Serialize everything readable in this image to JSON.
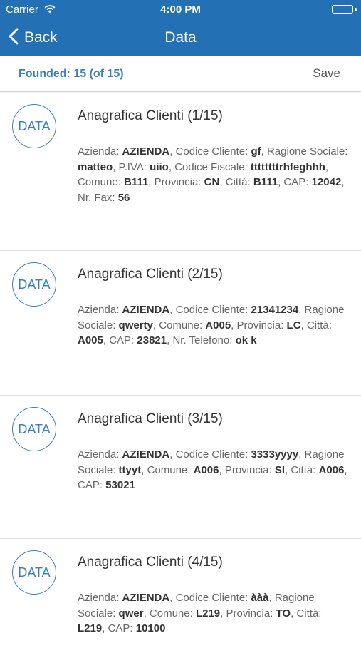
{
  "status_bar": {
    "carrier": "Carrier",
    "time": "4:00 PM",
    "battery_level": 1.0,
    "battery_color": "#7ed43c"
  },
  "nav": {
    "back_label": "Back",
    "title": "Data",
    "background": "#2370b5"
  },
  "info_bar": {
    "founded": "Founded: 15 (of 15)",
    "save_label": "Save"
  },
  "items": [
    {
      "badge": "DATA",
      "title": "Anagrafica Clienti (1/15)",
      "fields": [
        {
          "label": "Azienda: ",
          "value": "AZIENDA",
          "sep": ", "
        },
        {
          "label": "Codice Cliente: ",
          "value": "gf",
          "sep": ", "
        },
        {
          "label": "Ragione Sociale: ",
          "value": "matteo",
          "sep": ", "
        },
        {
          "label": "P.IVA: ",
          "value": "uiio",
          "sep": ", "
        },
        {
          "label": "Codice Fiscale: ",
          "value": "ttttttttrhfeghhh",
          "sep": ", "
        },
        {
          "label": "Comune: ",
          "value": "B111",
          "sep": ", "
        },
        {
          "label": "Provincia: ",
          "value": "CN",
          "sep": ", "
        },
        {
          "label": "Città: ",
          "value": "B111",
          "sep": ", "
        },
        {
          "label": "CAP: ",
          "value": "12042",
          "sep": ", "
        },
        {
          "label": "Nr. Fax: ",
          "value": "56",
          "sep": ""
        }
      ]
    },
    {
      "badge": "DATA",
      "title": "Anagrafica Clienti (2/15)",
      "fields": [
        {
          "label": "Azienda: ",
          "value": "AZIENDA",
          "sep": ", "
        },
        {
          "label": "Codice Cliente: ",
          "value": "21341234",
          "sep": ", "
        },
        {
          "label": "Ragione Sociale: ",
          "value": "qwerty",
          "sep": ", "
        },
        {
          "label": "Comune: ",
          "value": "A005",
          "sep": ", "
        },
        {
          "label": "Provincia: ",
          "value": "LC",
          "sep": ", "
        },
        {
          "label": "Città: ",
          "value": "A005",
          "sep": ", "
        },
        {
          "label": "CAP: ",
          "value": "23821",
          "sep": ", "
        },
        {
          "label": "Nr. Telefono: ",
          "value": "ok k",
          "sep": ""
        }
      ]
    },
    {
      "badge": "DATA",
      "title": "Anagrafica Clienti (3/15)",
      "fields": [
        {
          "label": "Azienda: ",
          "value": "AZIENDA",
          "sep": ", "
        },
        {
          "label": "Codice Cliente: ",
          "value": "3333yyyy",
          "sep": ", "
        },
        {
          "label": "Ragione Sociale: ",
          "value": "ttyyt",
          "sep": ", "
        },
        {
          "label": "Comune: ",
          "value": "A006",
          "sep": ", "
        },
        {
          "label": "Provincia: ",
          "value": "SI",
          "sep": ", "
        },
        {
          "label": "Città: ",
          "value": "A006",
          "sep": ", "
        },
        {
          "label": "CAP: ",
          "value": "53021",
          "sep": ""
        }
      ]
    },
    {
      "badge": "DATA",
      "title": "Anagrafica Clienti (4/15)",
      "fields": [
        {
          "label": "Azienda: ",
          "value": "AZIENDA",
          "sep": ", "
        },
        {
          "label": "Codice Cliente: ",
          "value": "ààà",
          "sep": ", "
        },
        {
          "label": "Ragione Sociale: ",
          "value": "qwer",
          "sep": ", "
        },
        {
          "label": "Comune: ",
          "value": "L219",
          "sep": ", "
        },
        {
          "label": "Provincia: ",
          "value": "TO",
          "sep": ", "
        },
        {
          "label": "Città: ",
          "value": "L219",
          "sep": ", "
        },
        {
          "label": "CAP: ",
          "value": "10100",
          "sep": ""
        }
      ]
    }
  ]
}
